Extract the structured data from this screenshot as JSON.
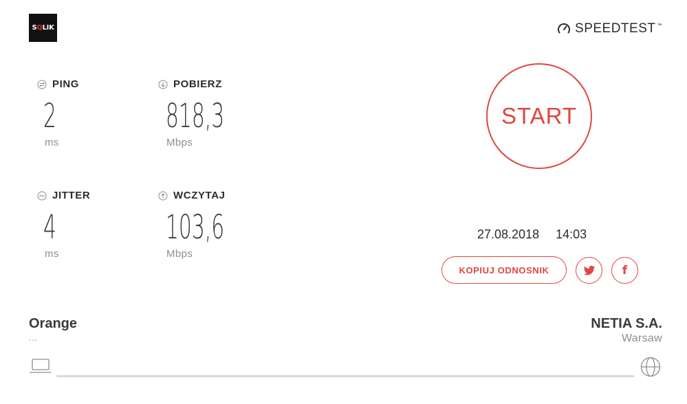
{
  "logo": {
    "prefix": "S",
    "q": "Q",
    "suffix": "LIK"
  },
  "brand": {
    "name": "SPEEDTEST",
    "icon": "gauge-icon"
  },
  "metrics": {
    "ping": {
      "label": "PING",
      "value": "2",
      "unit": "ms",
      "icon": "ping-icon"
    },
    "download": {
      "label": "POBIERZ",
      "value": "818,3",
      "unit": "Mbps",
      "icon": "download-arrow-icon"
    },
    "jitter": {
      "label": "JITTER",
      "value": "4",
      "unit": "ms",
      "icon": "jitter-wave-icon"
    },
    "upload": {
      "label": "WCZYTAJ",
      "value": "103,6",
      "unit": "Mbps",
      "icon": "upload-arrow-icon"
    }
  },
  "start_label": "START",
  "date": "27.08.2018",
  "time": "14:03",
  "share": {
    "copy_link_label": "KOPIUJ ODNOSNIK",
    "twitter_icon": "twitter-icon",
    "facebook_icon": "facebook-icon",
    "facebook_glyph": "f"
  },
  "isp": {
    "name": "Orange",
    "ip": "..."
  },
  "server": {
    "name": "NETIA S.A.",
    "location": "Warsaw"
  },
  "colors": {
    "accent": "#e0463f",
    "text": "#2b2b2b",
    "muted": "#8d8d8d",
    "track": "#d7d7d7"
  }
}
